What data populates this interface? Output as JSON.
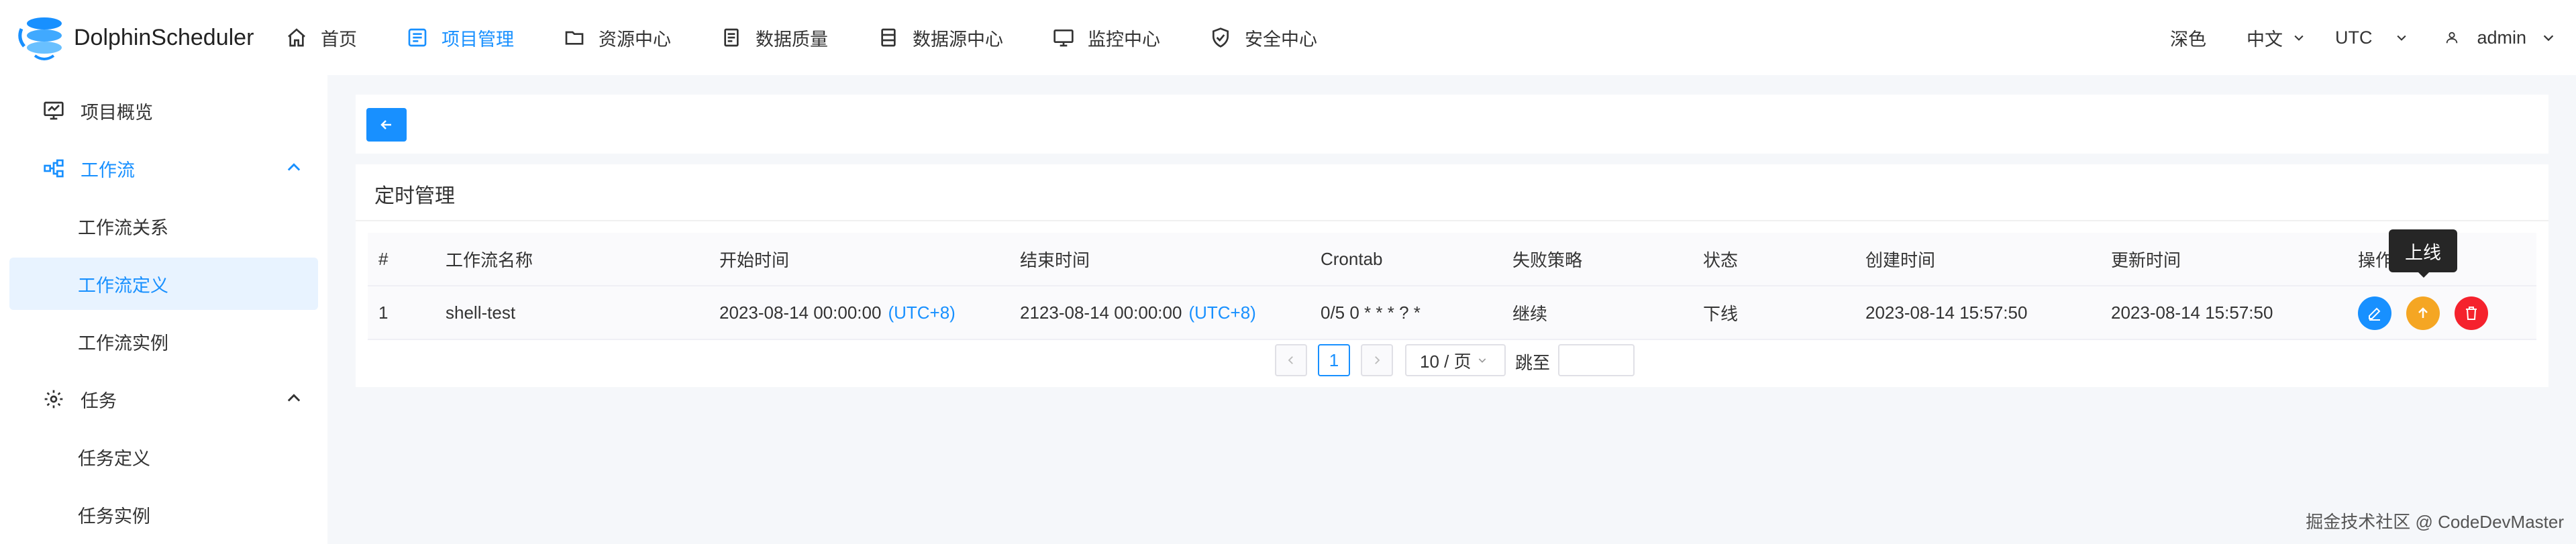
{
  "app": {
    "title": "DolphinScheduler"
  },
  "nav": {
    "items": [
      {
        "label": "首页",
        "icon": "home-icon"
      },
      {
        "label": "项目管理",
        "icon": "project-list-icon",
        "active": true
      },
      {
        "label": "资源中心",
        "icon": "folder-icon"
      },
      {
        "label": "数据质量",
        "icon": "data-quality-icon"
      },
      {
        "label": "数据源中心",
        "icon": "database-icon"
      },
      {
        "label": "监控中心",
        "icon": "monitor-icon"
      },
      {
        "label": "安全中心",
        "icon": "shield-icon"
      }
    ],
    "theme_label": "深色",
    "language_label": "中文",
    "timezone_label": "UTC",
    "user_label": "admin"
  },
  "sidebar": {
    "items": [
      {
        "label": "项目概览",
        "icon": "project-overview-icon"
      },
      {
        "label": "工作流",
        "icon": "workflow-icon",
        "expanded": true
      },
      {
        "label": "工作流关系"
      },
      {
        "label": "工作流定义",
        "selected": true
      },
      {
        "label": "工作流实例"
      },
      {
        "label": "任务",
        "icon": "gear-icon",
        "expanded": true
      },
      {
        "label": "任务定义"
      },
      {
        "label": "任务实例"
      }
    ]
  },
  "page": {
    "title": "定时管理",
    "table": {
      "headers": [
        "#",
        "工作流名称",
        "开始时间",
        "结束时间",
        "Crontab",
        "失败策略",
        "状态",
        "创建时间",
        "更新时间",
        "操作"
      ],
      "rows": [
        {
          "index": "1",
          "name": "shell-test",
          "start_time": "2023-08-14 00:00:00",
          "start_tz": "(UTC+8)",
          "end_time": "2123-08-14 00:00:00",
          "end_tz": "(UTC+8)",
          "crontab": "0/5 0 * * * ? *",
          "failure_strategy": "继续",
          "status": "下线",
          "create_time": "2023-08-14 15:57:50",
          "update_time": "2023-08-14 15:57:50"
        }
      ]
    },
    "tooltip": "上线",
    "pagination": {
      "current_page": "1",
      "page_size": "10 / 页",
      "jump_label": "跳至"
    }
  },
  "colors": {
    "primary": "#1890ff",
    "edit_button": "#1890ff",
    "online_button": "#f5a623",
    "delete_button": "#f5222d"
  },
  "watermark": "掘金技术社区 @ CodeDevMaster"
}
